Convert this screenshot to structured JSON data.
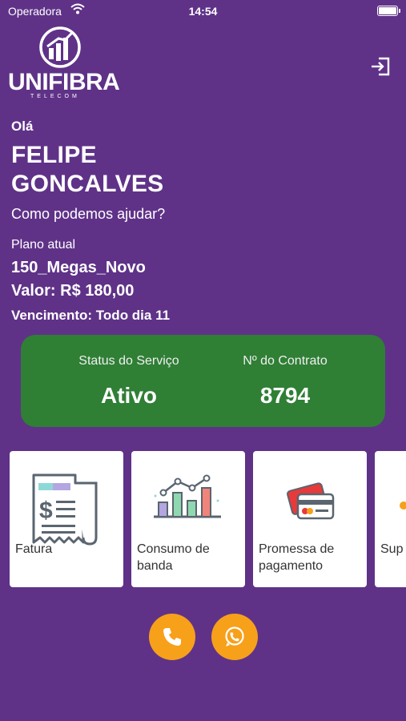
{
  "status_bar": {
    "carrier": "Operadora",
    "time": "14:54"
  },
  "logo": {
    "brand": "UNIFIBRA",
    "tagline": "TELECOM"
  },
  "header": {
    "greeting": "Olá",
    "user_name": "FELIPE GONCALVES",
    "help_text": "Como podemos ajudar?"
  },
  "plan": {
    "label": "Plano atual",
    "name": "150_Megas_Novo",
    "value": "Valor: R$ 180,00",
    "due": "Vencimento: Todo dia 11"
  },
  "status_card": {
    "service_label": "Status do Serviço",
    "service_value": "Ativo",
    "contract_label": "Nº do Contrato",
    "contract_value": "8794",
    "color": "#2f7f35"
  },
  "menu": [
    {
      "label": "Fatura",
      "icon": "invoice-icon"
    },
    {
      "label": "Consumo de banda",
      "icon": "bandwidth-chart-icon"
    },
    {
      "label": "Promessa de pagamento",
      "icon": "credit-card-icon"
    },
    {
      "label": "Sup",
      "icon": "support-icon"
    }
  ],
  "actions": {
    "phone_icon": "phone-icon",
    "whatsapp_icon": "whatsapp-icon",
    "accent_color": "#f7a01a"
  },
  "theme": {
    "background": "#5f3288"
  }
}
